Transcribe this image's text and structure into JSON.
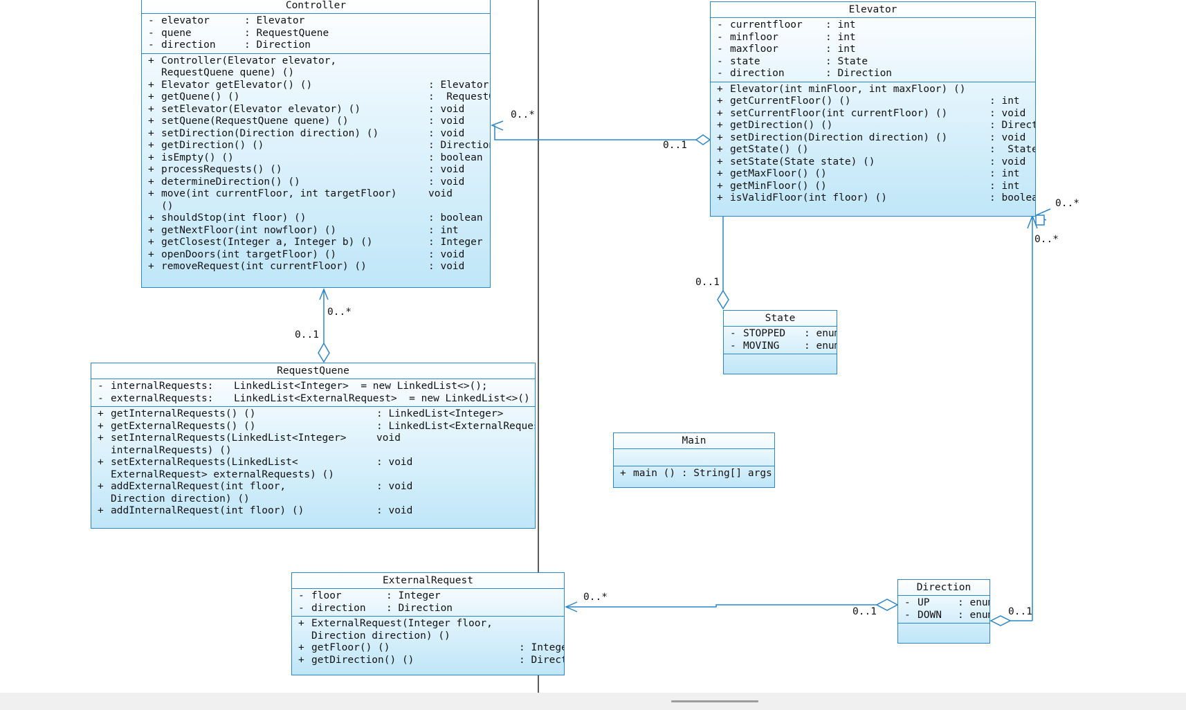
{
  "classes": {
    "controller": {
      "name": "Controller",
      "attributes": [
        {
          "vis": "-",
          "name": "elevator",
          "type": ": Elevator"
        },
        {
          "vis": "-",
          "name": "quene",
          "type": ": RequestQuene"
        },
        {
          "vis": "-",
          "name": "direction",
          "type": ": Direction"
        }
      ],
      "operations": [
        {
          "vis": "+",
          "line1": "Controller(Elevator elevator,",
          "line2": "RequestQuene quene) ()",
          "type": ""
        },
        {
          "vis": "+",
          "line1": "Elevator getElevator() ()",
          "type": ": Elevator"
        },
        {
          "vis": "+",
          "line1": "getQuene() ()",
          "type": ":  RequestQuene"
        },
        {
          "vis": "+",
          "line1": "setElevator(Elevator elevator) ()",
          "type": ": void"
        },
        {
          "vis": "+",
          "line1": "setQuene(RequestQuene quene) ()",
          "type": ": void"
        },
        {
          "vis": "+",
          "line1": "setDirection(Direction direction) ()",
          "type": ": void"
        },
        {
          "vis": "+",
          "line1": "getDirection() ()",
          "type": ": Direction"
        },
        {
          "vis": "+",
          "line1": "isEmpty() ()",
          "type": ": boolean"
        },
        {
          "vis": "+",
          "line1": "processRequests() ()",
          "type": ": void"
        },
        {
          "vis": "+",
          "line1": "determineDirection() ()",
          "type": ": void"
        },
        {
          "vis": "+",
          "line1": "move(int currentFloor, int targetFloor)",
          "line2": "()",
          "type": "void"
        },
        {
          "vis": "+",
          "line1": "shouldStop(int floor) ()",
          "type": ": boolean"
        },
        {
          "vis": "+",
          "line1": "getNextFloor(int nowfloor) ()",
          "type": ": int"
        },
        {
          "vis": "+",
          "line1": "getClosest(Integer a, Integer b) ()",
          "type": ": Integer"
        },
        {
          "vis": "+",
          "line1": "openDoors(int targetFloor) ()",
          "type": ": void"
        },
        {
          "vis": "+",
          "line1": "removeRequest(int currentFloor) ()",
          "type": ": void"
        }
      ]
    },
    "elevator": {
      "name": "Elevator",
      "attributes": [
        {
          "vis": "-",
          "name": "currentfloor",
          "type": ": int"
        },
        {
          "vis": "-",
          "name": "minfloor",
          "type": ": int"
        },
        {
          "vis": "-",
          "name": "maxfloor",
          "type": ": int"
        },
        {
          "vis": "-",
          "name": "state",
          "type": ": State"
        },
        {
          "vis": "-",
          "name": "direction",
          "type": ": Direction"
        }
      ],
      "operations": [
        {
          "vis": "+",
          "line1": "Elevator(int minFloor, int maxFloor) ()",
          "type": ""
        },
        {
          "vis": "+",
          "line1": "getCurrentFloor() ()",
          "type": ": int"
        },
        {
          "vis": "+",
          "line1": "setCurrentFloor(int currentFloor) ()",
          "type": ": void"
        },
        {
          "vis": "+",
          "line1": "getDirection() ()",
          "type": ": Direction"
        },
        {
          "vis": "+",
          "line1": "setDirection(Direction direction) ()",
          "type": ": void"
        },
        {
          "vis": "+",
          "line1": "getState() ()",
          "type": ":  State"
        },
        {
          "vis": "+",
          "line1": "setState(State state) ()",
          "type": ": void"
        },
        {
          "vis": "+",
          "line1": "getMaxFloor() ()",
          "type": ": int"
        },
        {
          "vis": "+",
          "line1": "getMinFloor() ()",
          "type": ": int"
        },
        {
          "vis": "+",
          "line1": "isValidFloor(int floor) ()",
          "type": ": boolean"
        }
      ]
    },
    "requestquene": {
      "name": "RequestQuene",
      "attributes": [
        {
          "vis": "-",
          "name": "internalRequests:",
          "type": "LinkedList<Integer>  = new LinkedList<>();"
        },
        {
          "vis": "-",
          "name": "externalRequests:",
          "type": "LinkedList<ExternalRequest>  = new LinkedList<>()"
        }
      ],
      "operations": [
        {
          "vis": "+",
          "line1": "getInternalRequests() ()",
          "type": ": LinkedList<Integer>"
        },
        {
          "vis": "+",
          "line1": "getExternalRequests() ()",
          "type": ": LinkedList<ExternalRequest>"
        },
        {
          "vis": "+",
          "line1": "setInternalRequests(LinkedList<Integer>",
          "line2": "internalRequests) ()",
          "type": "void"
        },
        {
          "vis": "+",
          "line1": "setExternalRequests(LinkedList<",
          "line2": "ExternalRequest> externalRequests) ()",
          "type": ": void"
        },
        {
          "vis": "+",
          "line1": "addExternalRequest(int floor,",
          "line2": "Direction direction) ()",
          "type": ": void"
        },
        {
          "vis": "+",
          "line1": "addInternalRequest(int floor) ()",
          "type": ": void"
        }
      ]
    },
    "state": {
      "name": "State",
      "attributes": [
        {
          "vis": "-",
          "name": "STOPPED",
          "type": ": enum"
        },
        {
          "vis": "-",
          "name": "MOVING",
          "type": ": enum"
        }
      ]
    },
    "main": {
      "name": "Main",
      "operations": [
        {
          "vis": "+",
          "line1": "main () : String[] args",
          "type": ""
        }
      ]
    },
    "externalrequest": {
      "name": "ExternalRequest",
      "attributes": [
        {
          "vis": "-",
          "name": "floor",
          "type": ": Integer"
        },
        {
          "vis": "-",
          "name": "direction",
          "type": ": Direction"
        }
      ],
      "operations": [
        {
          "vis": "+",
          "line1": "ExternalRequest(Integer floor,",
          "line2": "Direction direction) ()",
          "type": ""
        },
        {
          "vis": "+",
          "line1": "getFloor() ()",
          "type": ": Intege"
        },
        {
          "vis": "+",
          "line1": "getDirection() ()",
          "type": ": Direction"
        }
      ]
    },
    "direction": {
      "name": "Direction",
      "attributes": [
        {
          "vis": "-",
          "name": "UP",
          "type": ": enum"
        },
        {
          "vis": "-",
          "name": "DOWN",
          "type": ": enum"
        }
      ]
    }
  },
  "multiplicities": {
    "ctrl_elev_many": "0..*",
    "ctrl_elev_one": "0..1",
    "elev_right_top": "0..*",
    "elev_right_bottom": "0..*",
    "state_elev_one": "0..1",
    "ctrl_rq_many": "0..*",
    "ctrl_rq_one": "0..1",
    "ext_dir_many": "0..*",
    "ext_dir_one": "0..1",
    "dir_elev_one": "0..1"
  },
  "colors": {
    "border": "#2a86c9",
    "line": "#2a86c9"
  }
}
